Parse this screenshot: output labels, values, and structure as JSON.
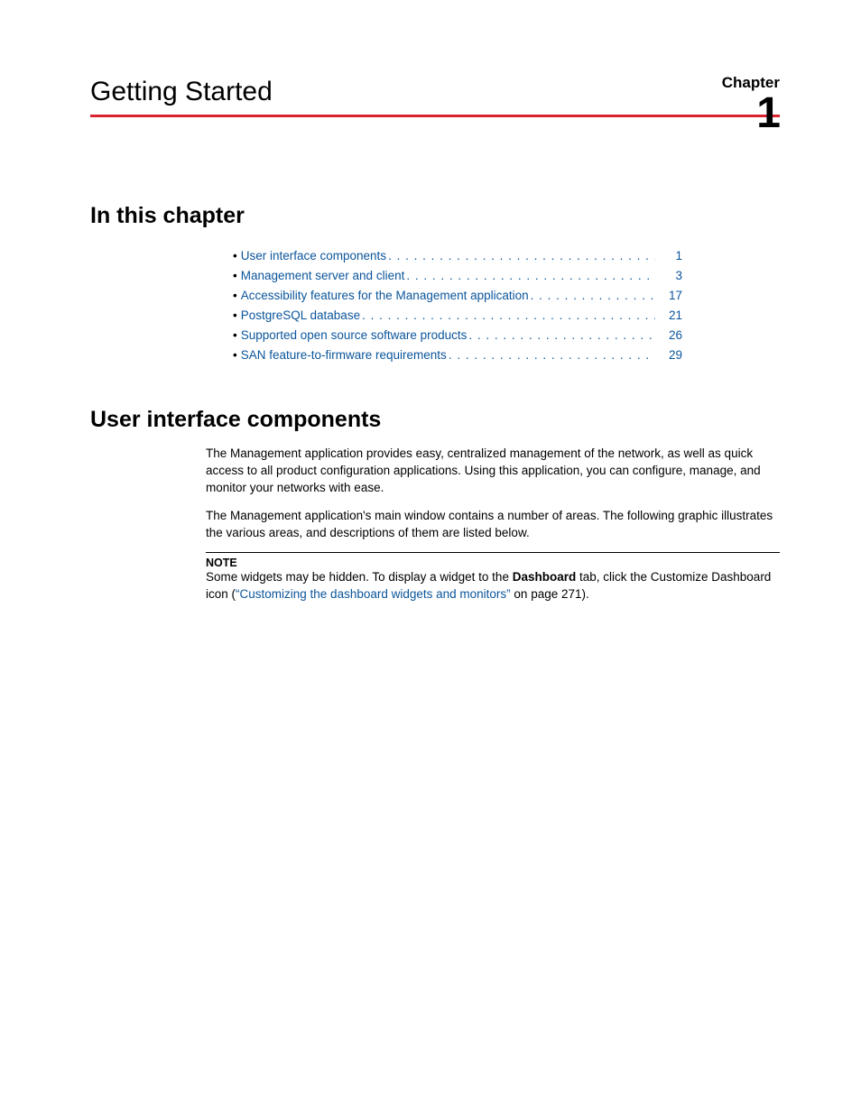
{
  "header": {
    "chapter_label": "Chapter",
    "chapter_number": "1",
    "title": "Getting Started"
  },
  "sections": {
    "in_this_chapter": "In this chapter",
    "user_interface_components": "User interface components"
  },
  "toc": [
    {
      "title": "User interface components",
      "page": "1"
    },
    {
      "title": "Management server and client",
      "page": "3"
    },
    {
      "title": "Accessibility features for the Management application",
      "page": "17"
    },
    {
      "title": "PostgreSQL database",
      "page": "21"
    },
    {
      "title": "Supported open source software products",
      "page": "26"
    },
    {
      "title": "SAN feature-to-firmware requirements",
      "page": "29"
    }
  ],
  "body": {
    "p1": "The Management application provides easy, centralized management of the network, as well as quick access to all product configuration applications. Using this application, you can configure, manage, and monitor your networks with ease.",
    "p2": "The Management application's main window contains a number of areas. The following graphic illustrates the various areas, and descriptions of them are listed below."
  },
  "note": {
    "label": "NOTE",
    "pre": "Some widgets may be hidden. To display a widget to the ",
    "bold": "Dashboard",
    "mid": " tab, click the Customize Dashboard icon (",
    "link": "“Customizing the dashboard widgets and monitors”",
    "post": " on page 271)."
  }
}
